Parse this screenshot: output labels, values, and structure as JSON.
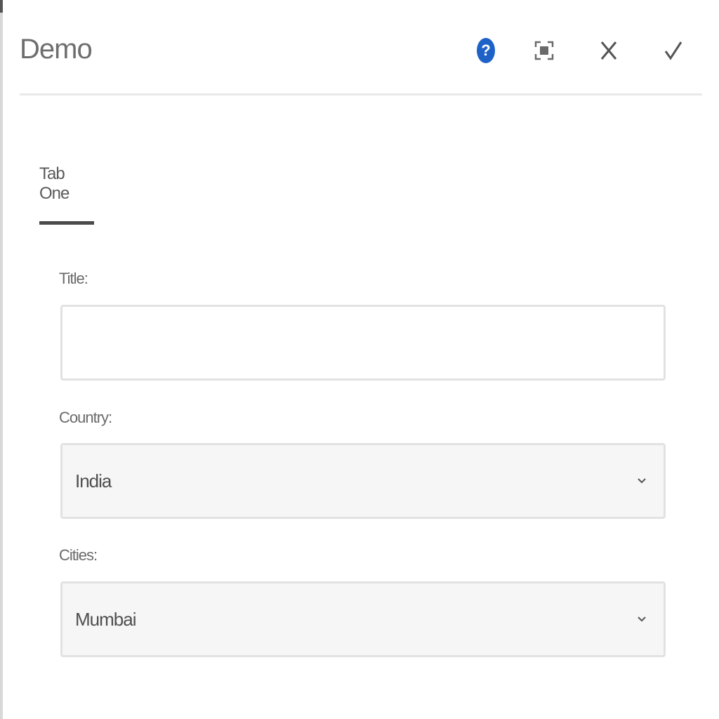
{
  "dialog": {
    "title": "Demo",
    "actions": {
      "help_icon": "help-icon",
      "fullscreen_icon": "fullscreen-icon",
      "close_icon": "close-icon",
      "done_icon": "checkmark-icon"
    }
  },
  "tabs": [
    {
      "label": "Tab One",
      "active": true
    }
  ],
  "form": {
    "title_field": {
      "label": "Title:",
      "value": "",
      "placeholder": ""
    },
    "country_field": {
      "label": "Country:",
      "value": "India"
    },
    "cities_field": {
      "label": "Cities:",
      "value": "Mumbai"
    }
  },
  "colors": {
    "accent": "#1f62c7",
    "tab_underline": "#4a4a4a",
    "divider": "#e9e9e9"
  }
}
